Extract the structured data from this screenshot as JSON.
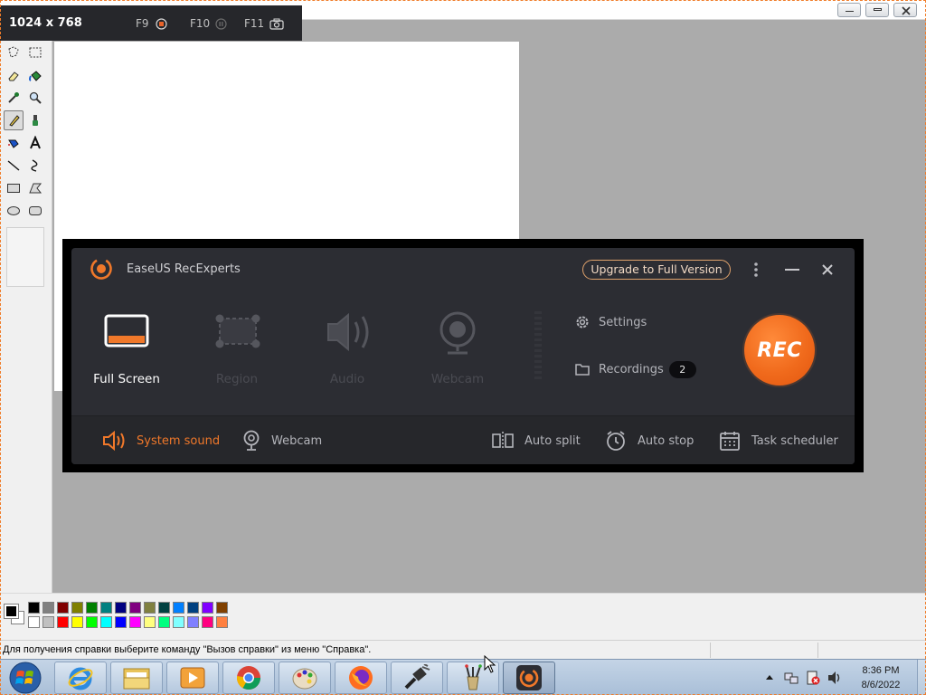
{
  "overlay": {
    "resolution": "1024 x 768",
    "f9": "F9",
    "f10": "F10",
    "f11": "F11"
  },
  "status": {
    "text": "Для получения справки выберите команду \"Вызов справки\" из меню \"Справка\"."
  },
  "palette": {
    "row1": [
      "#000000",
      "#808080",
      "#800000",
      "#808000",
      "#008000",
      "#008080",
      "#000080",
      "#800080",
      "#808040",
      "#004040",
      "#0080ff",
      "#004080",
      "#8000ff",
      "#804000"
    ],
    "row2": [
      "#ffffff",
      "#c0c0c0",
      "#ff0000",
      "#ffff00",
      "#00ff00",
      "#00ffff",
      "#0000ff",
      "#ff00ff",
      "#ffff80",
      "#00ff80",
      "#80ffff",
      "#8080ff",
      "#ff0080",
      "#ff8040"
    ]
  },
  "recorder": {
    "app_name": "EaseUS RecExperts",
    "upgrade_label": "Upgrade to Full Version",
    "modes": [
      {
        "label": "Full Screen",
        "icon": "monitor-icon"
      },
      {
        "label": "Region",
        "icon": "region-select-icon"
      },
      {
        "label": "Audio",
        "icon": "speaker-icon"
      },
      {
        "label": "Webcam",
        "icon": "webcam-icon"
      }
    ],
    "settings_label": "Settings",
    "recordings_label": "Recordings",
    "recordings_count": "2",
    "rec_label": "REC",
    "options": {
      "system_sound": "System sound",
      "webcam": "Webcam",
      "auto_split": "Auto split",
      "auto_stop": "Auto stop",
      "task_scheduler": "Task scheduler"
    },
    "accent": "#f0782a"
  },
  "taskbar": {
    "time": "8:36 PM",
    "date": "8/6/2022"
  }
}
